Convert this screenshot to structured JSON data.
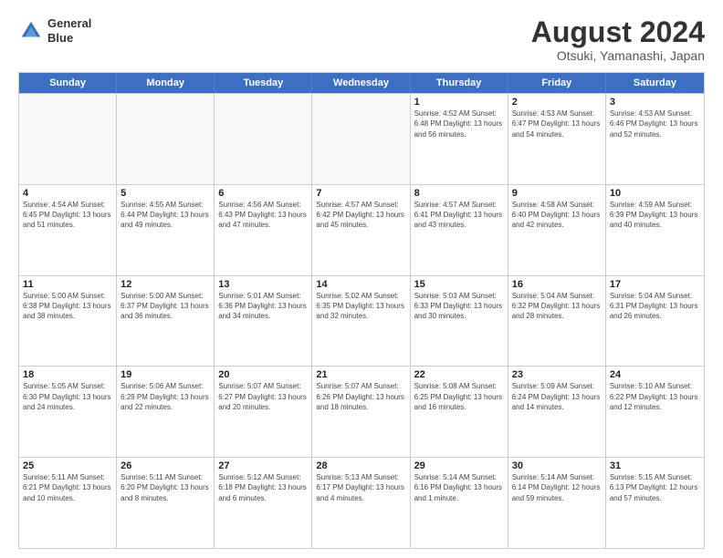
{
  "header": {
    "logo_line1": "General",
    "logo_line2": "Blue",
    "main_title": "August 2024",
    "subtitle": "Otsuki, Yamanashi, Japan"
  },
  "calendar": {
    "days": [
      "Sunday",
      "Monday",
      "Tuesday",
      "Wednesday",
      "Thursday",
      "Friday",
      "Saturday"
    ],
    "weeks": [
      [
        {
          "date": "",
          "info": ""
        },
        {
          "date": "",
          "info": ""
        },
        {
          "date": "",
          "info": ""
        },
        {
          "date": "",
          "info": ""
        },
        {
          "date": "1",
          "info": "Sunrise: 4:52 AM\nSunset: 6:48 PM\nDaylight: 13 hours\nand 56 minutes."
        },
        {
          "date": "2",
          "info": "Sunrise: 4:53 AM\nSunset: 6:47 PM\nDaylight: 13 hours\nand 54 minutes."
        },
        {
          "date": "3",
          "info": "Sunrise: 4:53 AM\nSunset: 6:46 PM\nDaylight: 13 hours\nand 52 minutes."
        }
      ],
      [
        {
          "date": "4",
          "info": "Sunrise: 4:54 AM\nSunset: 6:45 PM\nDaylight: 13 hours\nand 51 minutes."
        },
        {
          "date": "5",
          "info": "Sunrise: 4:55 AM\nSunset: 6:44 PM\nDaylight: 13 hours\nand 49 minutes."
        },
        {
          "date": "6",
          "info": "Sunrise: 4:56 AM\nSunset: 6:43 PM\nDaylight: 13 hours\nand 47 minutes."
        },
        {
          "date": "7",
          "info": "Sunrise: 4:57 AM\nSunset: 6:42 PM\nDaylight: 13 hours\nand 45 minutes."
        },
        {
          "date": "8",
          "info": "Sunrise: 4:57 AM\nSunset: 6:41 PM\nDaylight: 13 hours\nand 43 minutes."
        },
        {
          "date": "9",
          "info": "Sunrise: 4:58 AM\nSunset: 6:40 PM\nDaylight: 13 hours\nand 42 minutes."
        },
        {
          "date": "10",
          "info": "Sunrise: 4:59 AM\nSunset: 6:39 PM\nDaylight: 13 hours\nand 40 minutes."
        }
      ],
      [
        {
          "date": "11",
          "info": "Sunrise: 5:00 AM\nSunset: 6:38 PM\nDaylight: 13 hours\nand 38 minutes."
        },
        {
          "date": "12",
          "info": "Sunrise: 5:00 AM\nSunset: 6:37 PM\nDaylight: 13 hours\nand 36 minutes."
        },
        {
          "date": "13",
          "info": "Sunrise: 5:01 AM\nSunset: 6:36 PM\nDaylight: 13 hours\nand 34 minutes."
        },
        {
          "date": "14",
          "info": "Sunrise: 5:02 AM\nSunset: 6:35 PM\nDaylight: 13 hours\nand 32 minutes."
        },
        {
          "date": "15",
          "info": "Sunrise: 5:03 AM\nSunset: 6:33 PM\nDaylight: 13 hours\nand 30 minutes."
        },
        {
          "date": "16",
          "info": "Sunrise: 5:04 AM\nSunset: 6:32 PM\nDaylight: 13 hours\nand 28 minutes."
        },
        {
          "date": "17",
          "info": "Sunrise: 5:04 AM\nSunset: 6:31 PM\nDaylight: 13 hours\nand 26 minutes."
        }
      ],
      [
        {
          "date": "18",
          "info": "Sunrise: 5:05 AM\nSunset: 6:30 PM\nDaylight: 13 hours\nand 24 minutes."
        },
        {
          "date": "19",
          "info": "Sunrise: 5:06 AM\nSunset: 6:29 PM\nDaylight: 13 hours\nand 22 minutes."
        },
        {
          "date": "20",
          "info": "Sunrise: 5:07 AM\nSunset: 6:27 PM\nDaylight: 13 hours\nand 20 minutes."
        },
        {
          "date": "21",
          "info": "Sunrise: 5:07 AM\nSunset: 6:26 PM\nDaylight: 13 hours\nand 18 minutes."
        },
        {
          "date": "22",
          "info": "Sunrise: 5:08 AM\nSunset: 6:25 PM\nDaylight: 13 hours\nand 16 minutes."
        },
        {
          "date": "23",
          "info": "Sunrise: 5:09 AM\nSunset: 6:24 PM\nDaylight: 13 hours\nand 14 minutes."
        },
        {
          "date": "24",
          "info": "Sunrise: 5:10 AM\nSunset: 6:22 PM\nDaylight: 13 hours\nand 12 minutes."
        }
      ],
      [
        {
          "date": "25",
          "info": "Sunrise: 5:11 AM\nSunset: 6:21 PM\nDaylight: 13 hours\nand 10 minutes."
        },
        {
          "date": "26",
          "info": "Sunrise: 5:11 AM\nSunset: 6:20 PM\nDaylight: 13 hours\nand 8 minutes."
        },
        {
          "date": "27",
          "info": "Sunrise: 5:12 AM\nSunset: 6:18 PM\nDaylight: 13 hours\nand 6 minutes."
        },
        {
          "date": "28",
          "info": "Sunrise: 5:13 AM\nSunset: 6:17 PM\nDaylight: 13 hours\nand 4 minutes."
        },
        {
          "date": "29",
          "info": "Sunrise: 5:14 AM\nSunset: 6:16 PM\nDaylight: 13 hours\nand 1 minute."
        },
        {
          "date": "30",
          "info": "Sunrise: 5:14 AM\nSunset: 6:14 PM\nDaylight: 12 hours\nand 59 minutes."
        },
        {
          "date": "31",
          "info": "Sunrise: 5:15 AM\nSunset: 6:13 PM\nDaylight: 12 hours\nand 57 minutes."
        }
      ]
    ]
  }
}
